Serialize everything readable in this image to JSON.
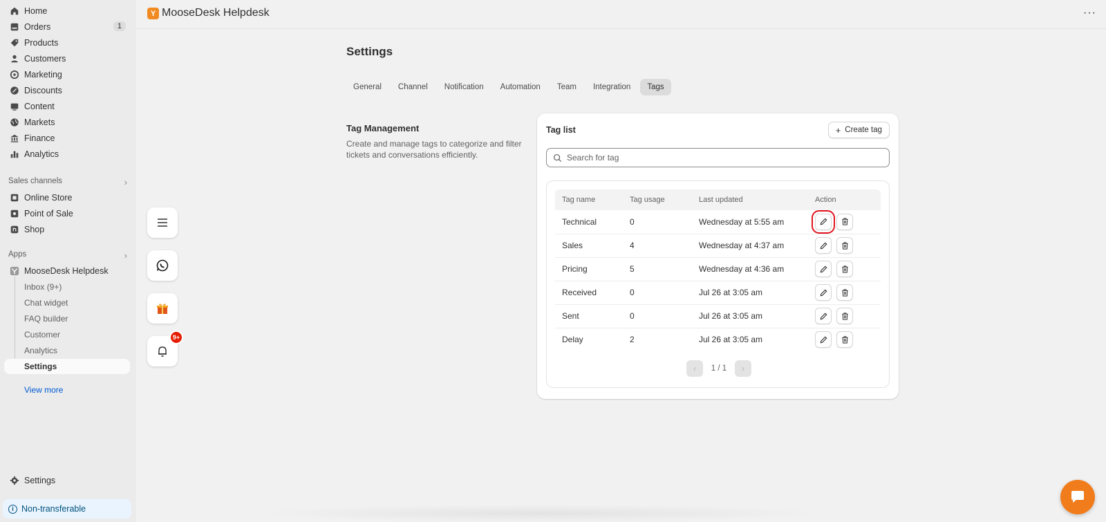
{
  "sidebar": {
    "nav": [
      {
        "label": "Home",
        "icon": "home-icon"
      },
      {
        "label": "Orders",
        "icon": "orders-icon",
        "badge": "1"
      },
      {
        "label": "Products",
        "icon": "tag-icon"
      },
      {
        "label": "Customers",
        "icon": "person-icon"
      },
      {
        "label": "Marketing",
        "icon": "target-icon"
      },
      {
        "label": "Discounts",
        "icon": "discount-icon"
      },
      {
        "label": "Content",
        "icon": "content-icon"
      },
      {
        "label": "Markets",
        "icon": "globe-icon"
      },
      {
        "label": "Finance",
        "icon": "bank-icon"
      },
      {
        "label": "Analytics",
        "icon": "bar-chart-icon"
      }
    ],
    "sales_channels_label": "Sales channels",
    "channels": [
      {
        "label": "Online Store",
        "icon": "store-icon"
      },
      {
        "label": "Point of Sale",
        "icon": "pos-icon"
      },
      {
        "label": "Shop",
        "icon": "shop-icon"
      }
    ],
    "apps_label": "Apps",
    "app_name": "MooseDesk Helpdesk",
    "app_subitems": [
      "Inbox (9+)",
      "Chat widget",
      "FAQ builder",
      "Customer",
      "Analytics",
      "Settings"
    ],
    "view_more": "View more",
    "settings_label": "Settings",
    "notice": "Non-transferable"
  },
  "topbar": {
    "app_title": "MooseDesk Helpdesk",
    "more_label": "···"
  },
  "floating": {
    "notif_badge": "9+"
  },
  "page": {
    "title": "Settings",
    "tabs": [
      "General",
      "Channel",
      "Notification",
      "Automation",
      "Team",
      "Integration",
      "Tags"
    ],
    "active_tab": "Tags",
    "section_title": "Tag Management",
    "section_desc": "Create and manage tags to categorize and filter tickets and conversations efficiently."
  },
  "card": {
    "title": "Tag list",
    "create_label": "Create tag",
    "search_placeholder": "Search for tag",
    "columns": [
      "Tag name",
      "Tag usage",
      "Last updated",
      "Action"
    ],
    "rows": [
      {
        "name": "Technical",
        "usage": "0",
        "updated": "Wednesday at 5:55 am"
      },
      {
        "name": "Sales",
        "usage": "4",
        "updated": "Wednesday at 4:37 am"
      },
      {
        "name": "Pricing",
        "usage": "5",
        "updated": "Wednesday at 4:36 am"
      },
      {
        "name": "Received",
        "usage": "0",
        "updated": "Jul 26 at 3:05 am"
      },
      {
        "name": "Sent",
        "usage": "0",
        "updated": "Jul 26 at 3:05 am"
      },
      {
        "name": "Delay",
        "usage": "2",
        "updated": "Jul 26 at 3:05 am"
      }
    ],
    "pager": "1 / 1"
  },
  "colors": {
    "accent": "#f07c1c",
    "highlight": "#e0141e",
    "link": "#005bd3",
    "badge": "#e51c00"
  }
}
